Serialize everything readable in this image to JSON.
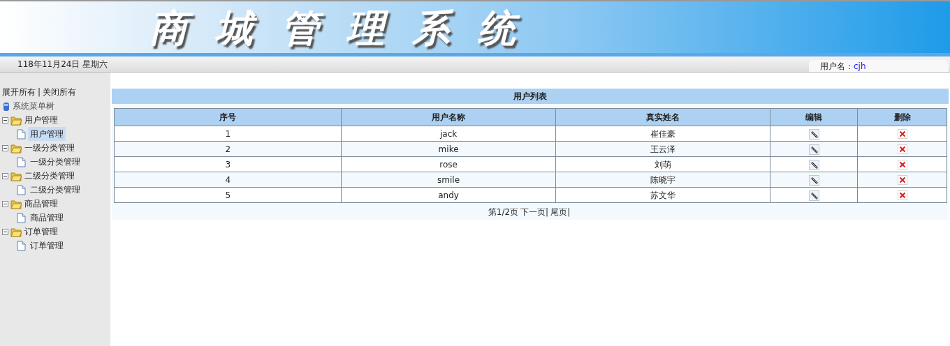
{
  "header": {
    "title": "商城管理系统"
  },
  "status_bar": {
    "date": "118年11月24日 星期六",
    "user_label": "用户名：",
    "user_name": "cjh"
  },
  "sidebar": {
    "actions": [
      "展开所有",
      "关闭所有"
    ],
    "separator": "|",
    "root": "系统菜单树",
    "items": [
      {
        "label": "用户管理",
        "expanded": true,
        "children": [
          {
            "label": "用户管理",
            "selected": true
          }
        ]
      },
      {
        "label": "一级分类管理",
        "expanded": true,
        "children": [
          {
            "label": "一级分类管理",
            "selected": false
          }
        ]
      },
      {
        "label": "二级分类管理",
        "expanded": true,
        "children": [
          {
            "label": "二级分类管理",
            "selected": false
          }
        ]
      },
      {
        "label": "商品管理",
        "expanded": true,
        "children": [
          {
            "label": "商品管理",
            "selected": false
          }
        ]
      },
      {
        "label": "订单管理",
        "expanded": true,
        "children": [
          {
            "label": "订单管理",
            "selected": false
          }
        ]
      }
    ]
  },
  "table": {
    "title": "用户列表",
    "columns": [
      "序号",
      "用户名称",
      "真实姓名",
      "编辑",
      "删除"
    ],
    "rows": [
      {
        "index": "1",
        "username": "jack",
        "realname": "崔佳豪"
      },
      {
        "index": "2",
        "username": "mike",
        "realname": "王云泽"
      },
      {
        "index": "3",
        "username": "rose",
        "realname": "刘萌"
      },
      {
        "index": "4",
        "username": "smile",
        "realname": "陈晓宇"
      },
      {
        "index": "5",
        "username": "andy",
        "realname": "苏文华"
      }
    ]
  },
  "pager": {
    "info": "第1/2页",
    "links": [
      "下一页|",
      "尾页|"
    ]
  }
}
